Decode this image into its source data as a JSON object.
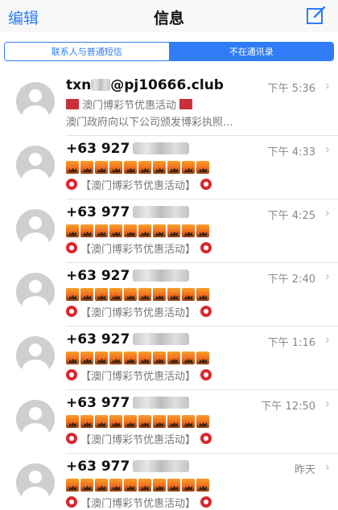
{
  "nav": {
    "edit": "编辑",
    "title": "信息"
  },
  "segment": {
    "left": "联系人与普通短信",
    "right": "不在通讯录"
  },
  "colors": {
    "accent": "#2f7cf6",
    "badge_red": "#d9282f"
  },
  "messages": [
    {
      "sender": "txn",
      "sender_suffix": "@pj10666.club",
      "time": "下午 5:36",
      "title": "澳门博彩节优惠活动",
      "body": "澳门政府向以下公司颁发博彩执照..."
    },
    {
      "sender": "+63 927",
      "time": "下午 4:33",
      "title": "【澳门博彩节优惠活动】"
    },
    {
      "sender": "+63 977",
      "time": "下午 4:25",
      "title": "【澳门博彩节优惠活动】"
    },
    {
      "sender": "+63 927",
      "time": "下午 2:40",
      "title": "【澳门博彩节优惠活动】"
    },
    {
      "sender": "+63 927",
      "time": "下午 1:16",
      "title": "【澳门博彩节优惠活动】"
    },
    {
      "sender": "+63 977",
      "time": "下午 12:50",
      "title": "【澳门博彩节优惠活动】"
    },
    {
      "sender": "+63 977",
      "time": "昨天",
      "title": "【澳门博彩节优惠活动】"
    }
  ]
}
